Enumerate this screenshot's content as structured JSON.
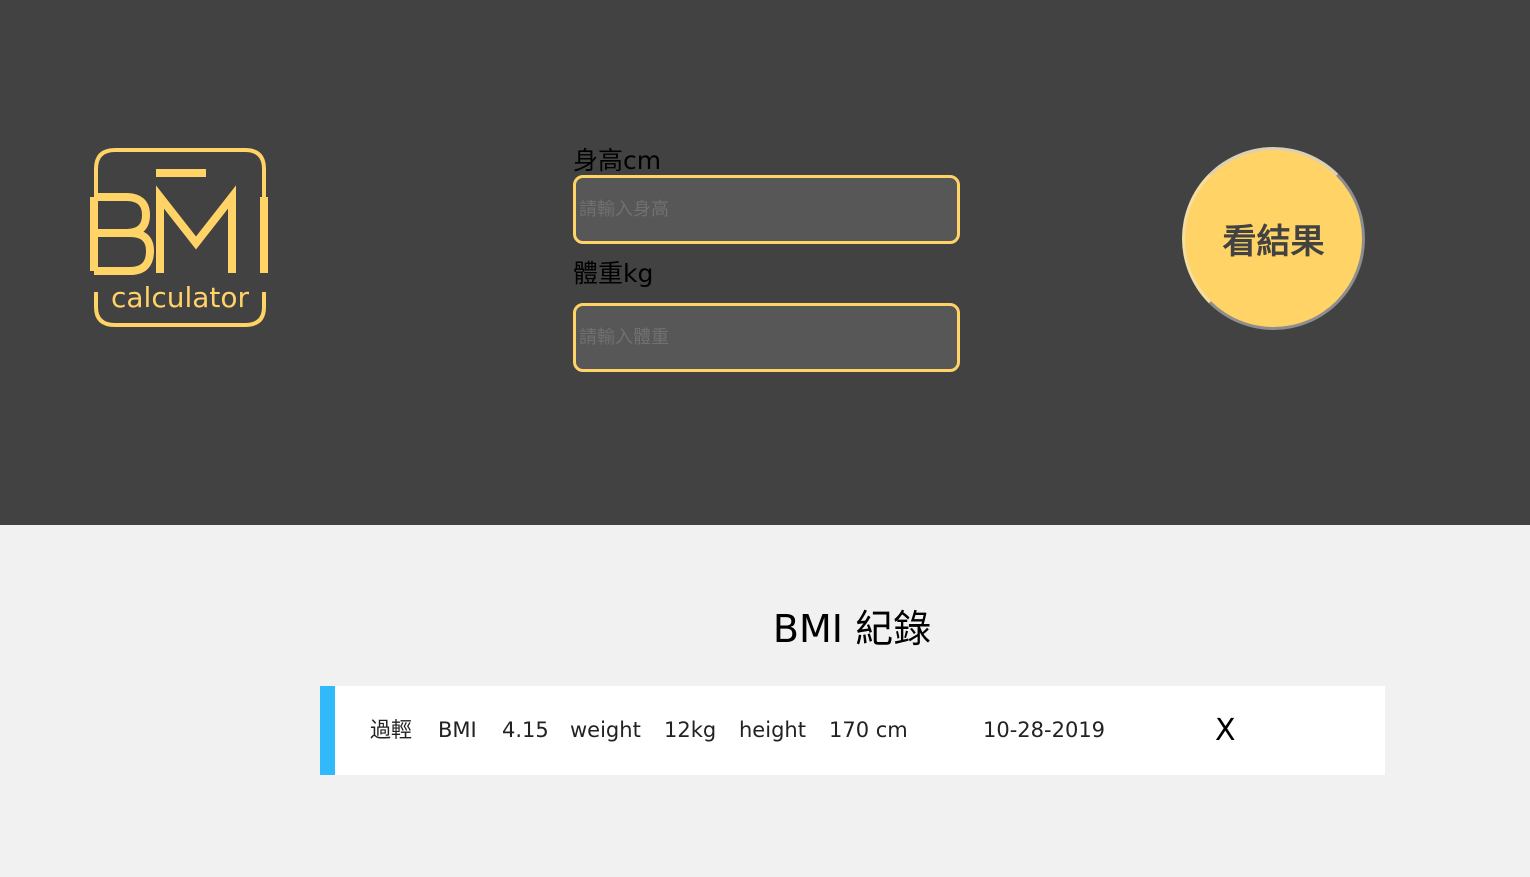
{
  "logo": {
    "word": "BMI",
    "subtitle": "calculator"
  },
  "form": {
    "height_label": "身高cm",
    "height_placeholder": "請輸入身高",
    "weight_label": "體重kg",
    "weight_placeholder": "請輸入體重"
  },
  "result_button": "看結果",
  "records_title": "BMI 紀錄",
  "records": [
    {
      "status": "過輕",
      "bmi_label": "BMI",
      "bmi_value": "4.15",
      "weight_label": "weight",
      "weight_value": "12kg",
      "height_label": "height",
      "height_value": "170 cm",
      "date": "10-28-2019",
      "delete_label": "X",
      "status_color": "#31baf9"
    }
  ],
  "colors": {
    "header_bg": "#424242",
    "accent": "#ffd366",
    "page_bg": "#f1f1f1"
  }
}
